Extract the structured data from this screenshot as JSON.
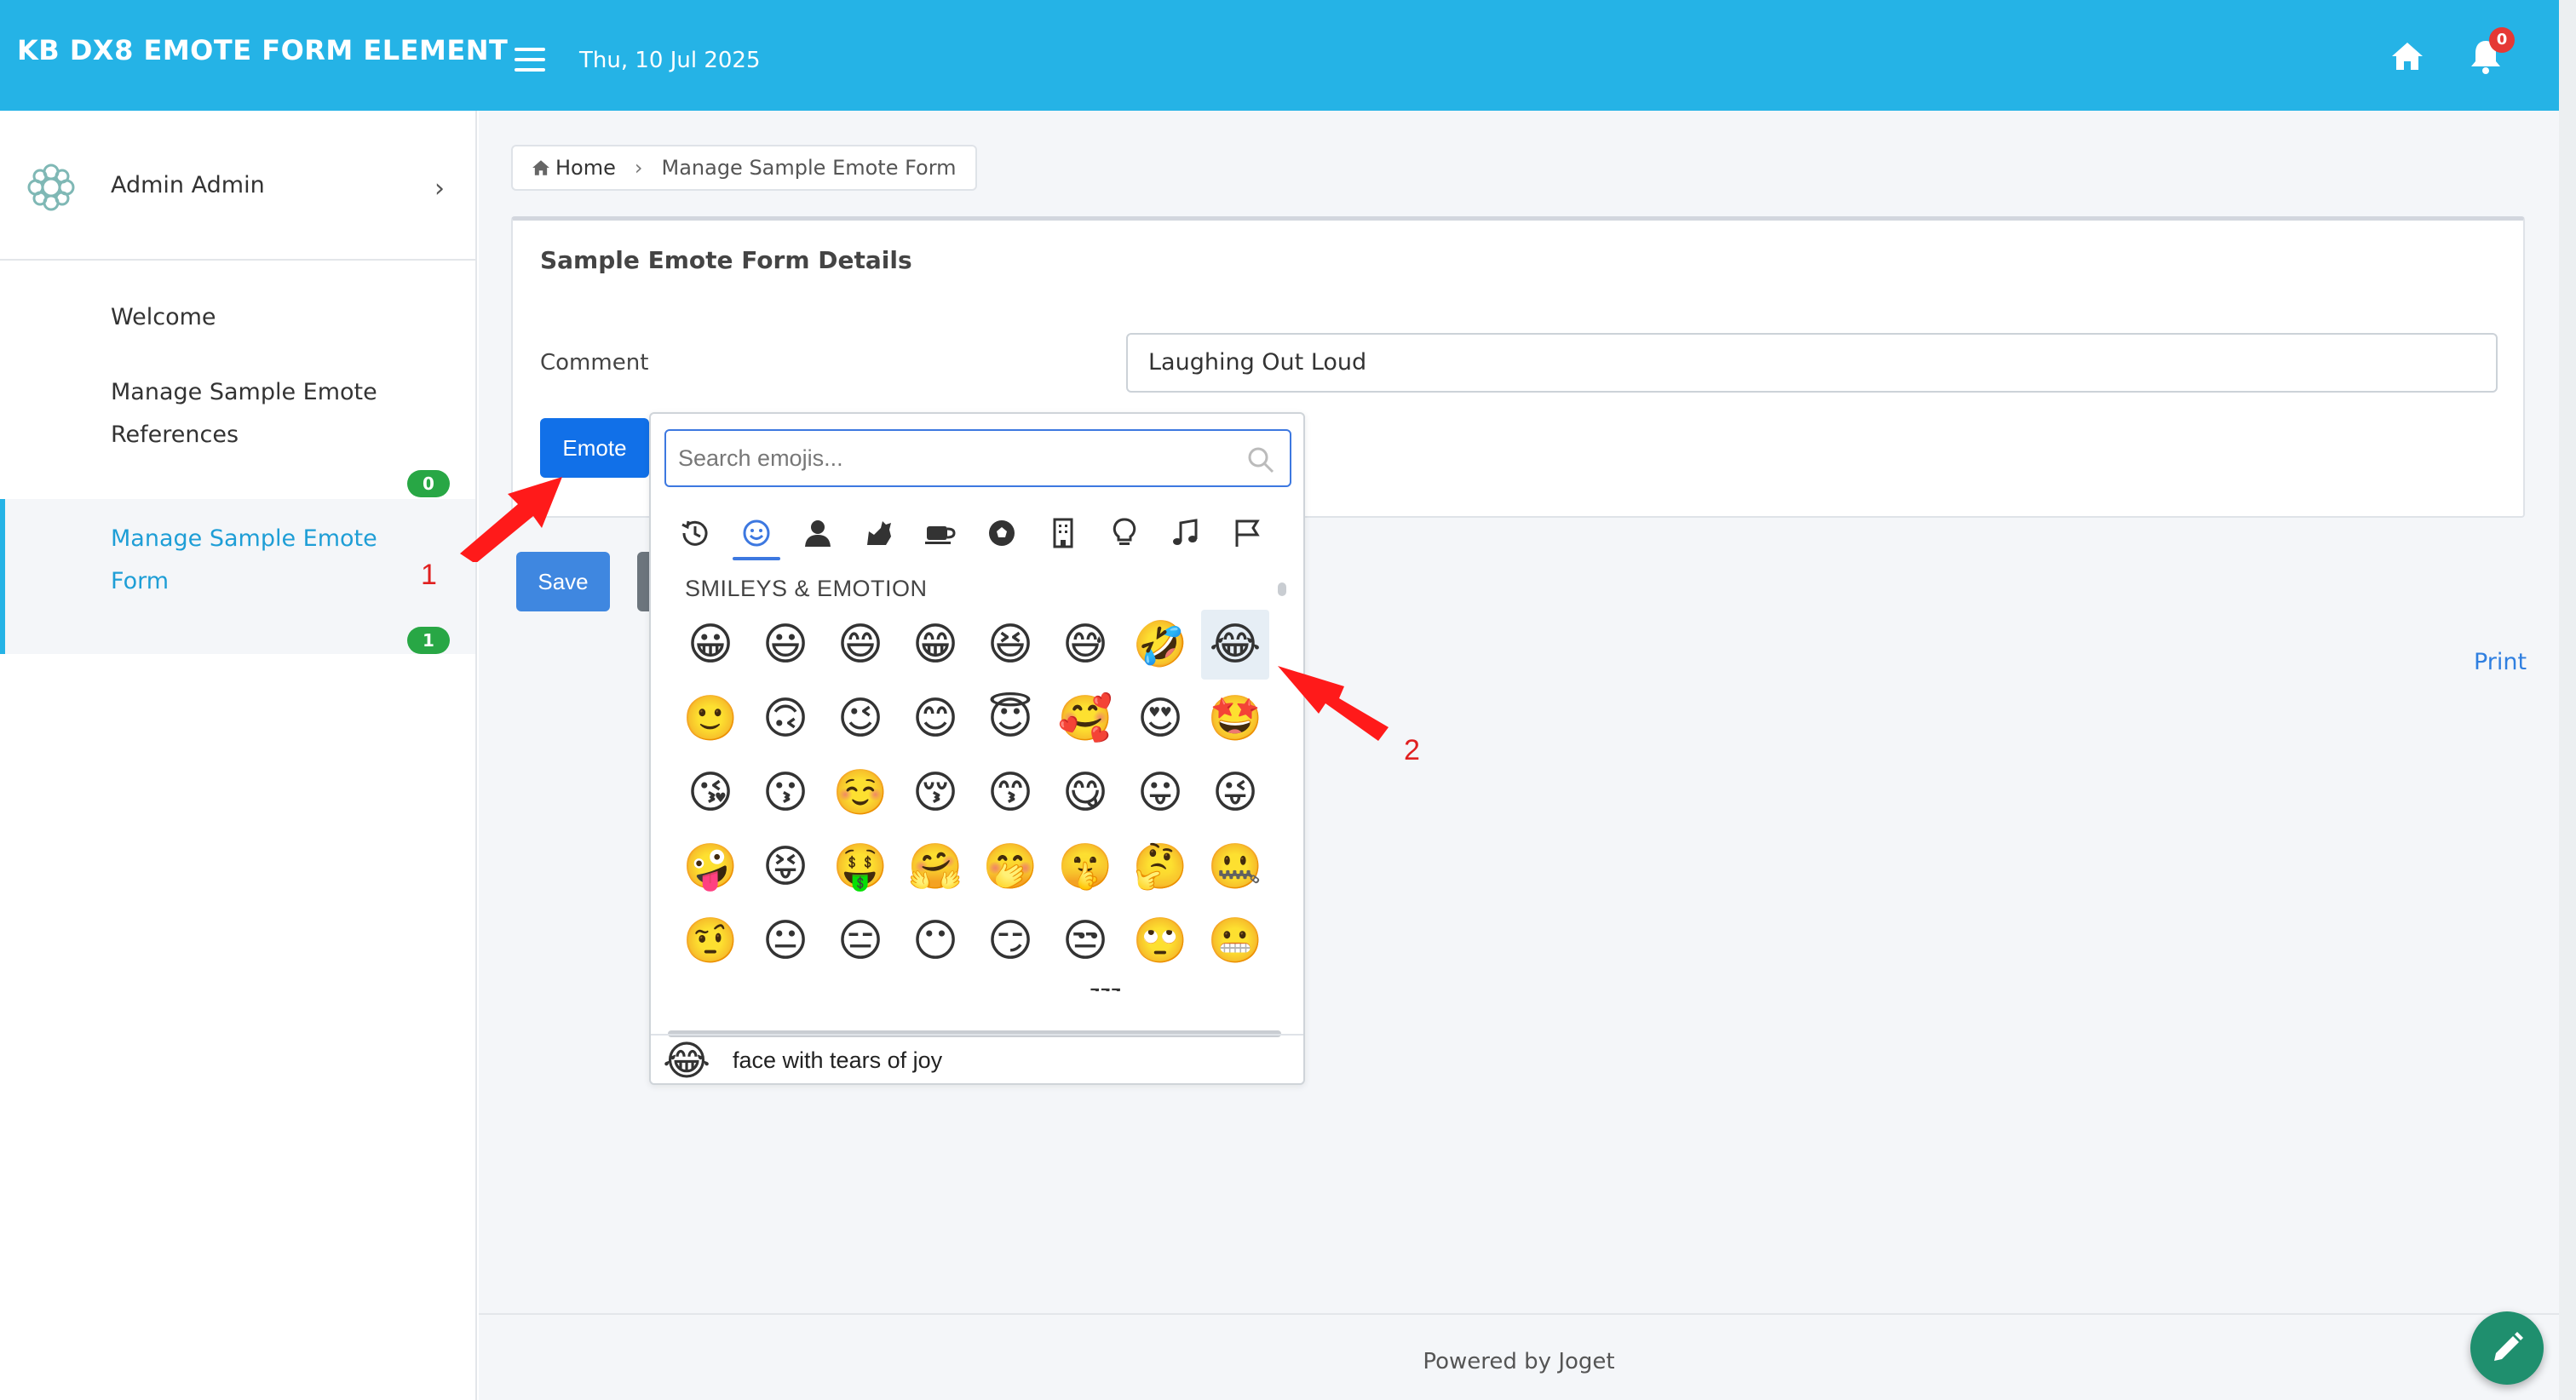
{
  "header": {
    "title": "KB DX8 EMOTE FORM ELEMENT",
    "date": "Thu, 10 Jul 2025",
    "notification_count": "0"
  },
  "sidebar": {
    "user_name": "Admin Admin",
    "items": [
      {
        "label": "Welcome"
      },
      {
        "label": "Manage Sample Emote References",
        "badge": "0"
      },
      {
        "label": "Manage Sample Emote Form",
        "badge": "1",
        "active": true
      }
    ]
  },
  "breadcrumb": {
    "home": "Home",
    "current": "Manage Sample Emote Form"
  },
  "form": {
    "title": "Sample Emote Form Details",
    "comment_label": "Comment",
    "comment_value": "Laughing Out Loud",
    "emote_button": "Emote",
    "save_button": "Save",
    "print_link": "Print"
  },
  "picker": {
    "search_placeholder": "Search emojis...",
    "categories": [
      "recent-icon",
      "smiley-icon",
      "person-icon",
      "animal-icon",
      "food-icon",
      "sports-icon",
      "building-icon",
      "bulb-icon",
      "music-icon",
      "flag-icon"
    ],
    "active_category": 1,
    "section_title": "SMILEYS & EMOTION",
    "emojis": [
      [
        "😀",
        "😃",
        "😄",
        "😁",
        "😆",
        "😅",
        "🤣",
        "😂"
      ],
      [
        "🙂",
        "🙃",
        "😉",
        "😊",
        "😇",
        "🥰",
        "😍",
        "🤩"
      ],
      [
        "😘",
        "😗",
        "☺️",
        "😚",
        "😙",
        "😋",
        "😛",
        "😜"
      ],
      [
        "🤪",
        "😝",
        "🤑",
        "🤗",
        "🤭",
        "🤫",
        "🤔",
        "🤐"
      ],
      [
        "🤨",
        "😐",
        "😑",
        "😶",
        "😏",
        "😒",
        "🙄",
        "😬"
      ],
      [
        "🤥",
        "😌",
        "😔",
        "😪",
        "🤤",
        "😴",
        "😷",
        "🤒"
      ]
    ],
    "preview_emoji": "😂",
    "preview_name": "face with tears of joy"
  },
  "annotations": {
    "label_1": "1",
    "label_2": "2",
    "arrow_color": "#ff1a1a"
  },
  "footer": {
    "text": "Powered by Joget"
  },
  "colors": {
    "header": "#25b3e6",
    "primary": "#1170e8",
    "badge": "#28a745",
    "fab": "#1f8f6e"
  }
}
